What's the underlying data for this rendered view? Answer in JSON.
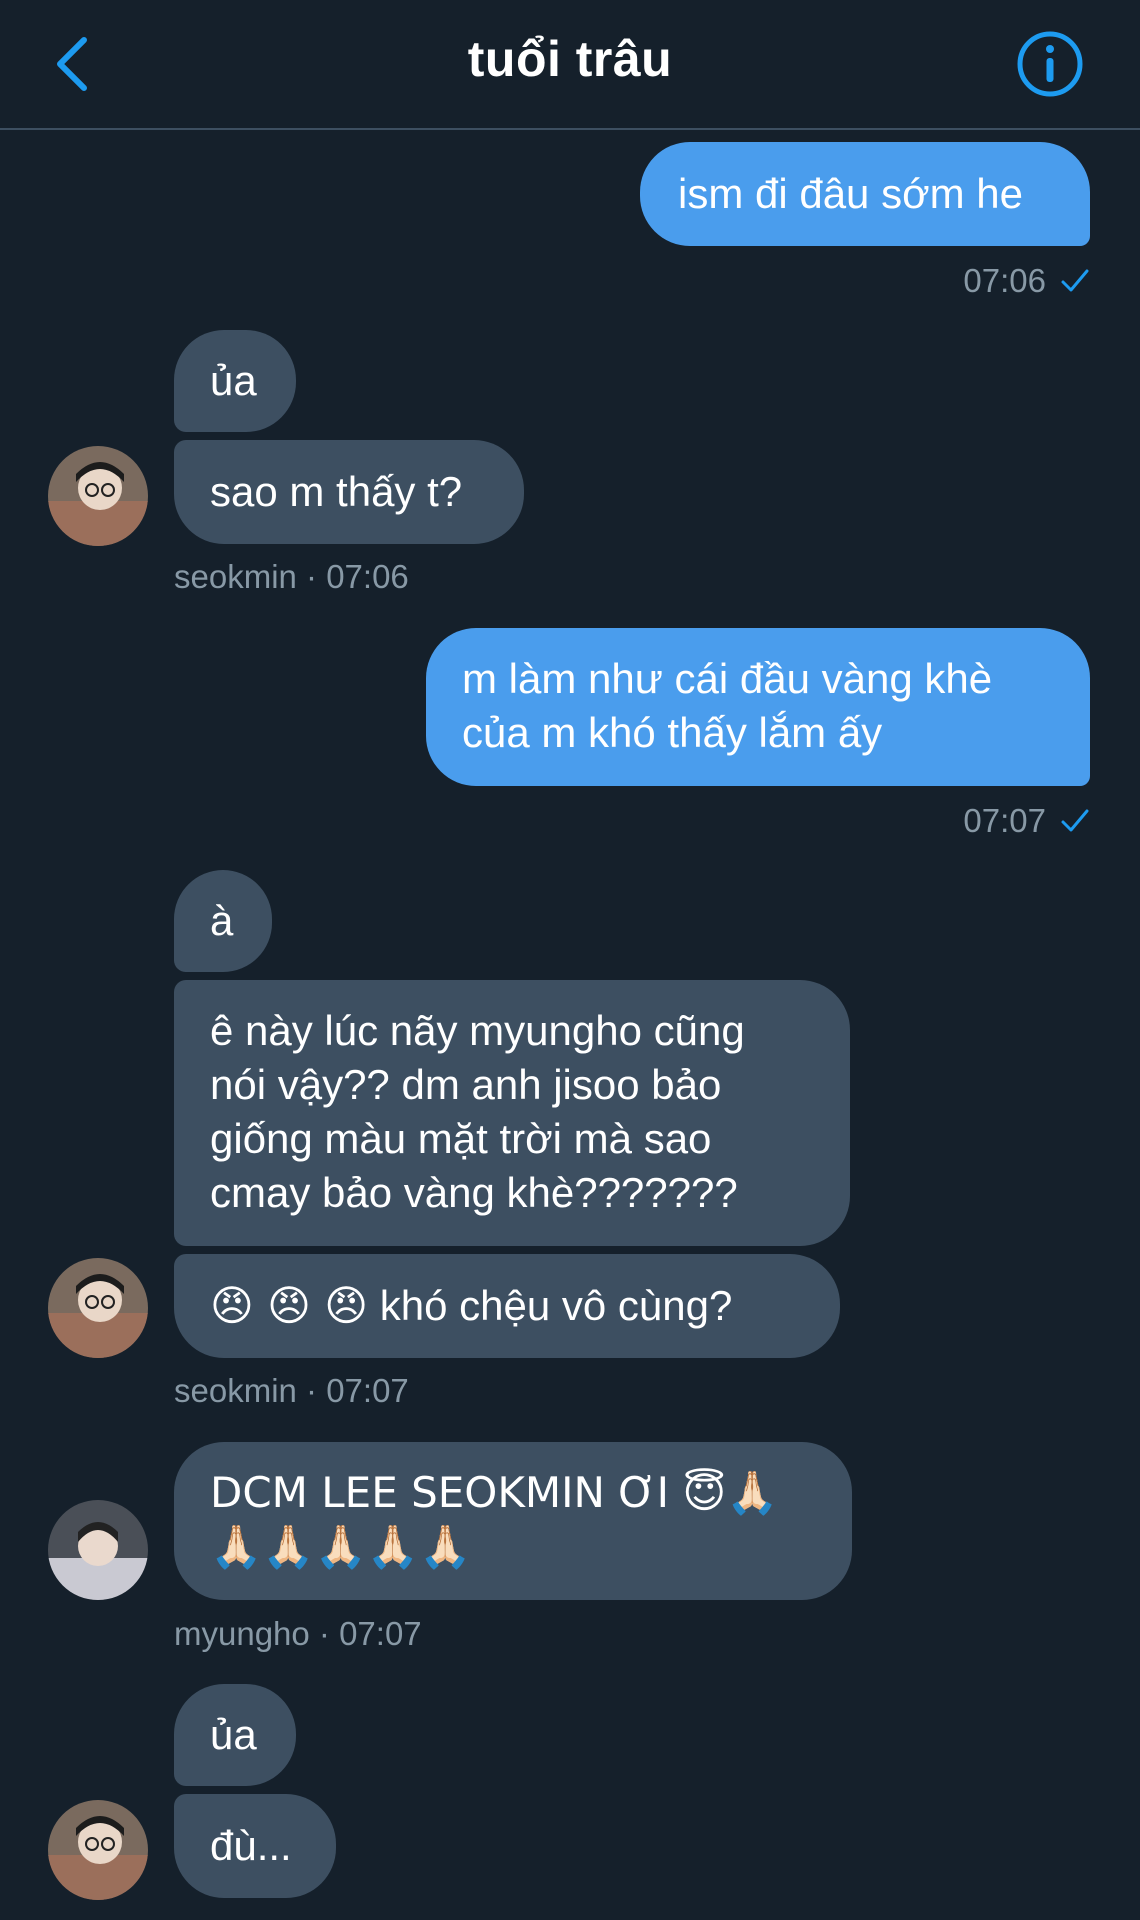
{
  "header": {
    "title": "tuổi trâu",
    "back_icon": "chevron-left-icon",
    "info_icon": "info-circle-icon",
    "accent": "#1d9bf0"
  },
  "colors": {
    "background": "#15202b",
    "outgoing_bubble": "#4a9ded",
    "incoming_bubble": "#3d4f61",
    "meta_text": "#8899a6"
  },
  "messages": {
    "m1": {
      "text": "ism đi đâu sớm he",
      "time": "07:06"
    },
    "m2a": {
      "text": "ủa"
    },
    "m2b": {
      "text": "sao m thấy t?"
    },
    "m2_meta": "seokmin · 07:06",
    "m3": {
      "line1": "m làm như cái đầu vàng khè",
      "line2": "của m khó thấy lắm ấy",
      "time": "07:07"
    },
    "m4a": {
      "text": "à"
    },
    "m4b": {
      "line1": "ê này lúc nãy myungho cũng",
      "line2": "nói vậy?? dm anh jisoo bảo",
      "line3": "giống màu mặt trời mà sao",
      "line4": "cmay bảo vàng khè???????"
    },
    "m4c": {
      "emoji": "😠 😠 😠",
      "text": "khó chệu vô cùng?"
    },
    "m4_meta": "seokmin · 07:07",
    "m5": {
      "line1": "DCM LEE SEOKMIN ƠI 😇🙏🏻",
      "line2": "🙏🏻🙏🏻🙏🏻🙏🏻🙏🏻"
    },
    "m5_meta": "myungho · 07:07",
    "m6a": {
      "text": "ủa"
    },
    "m6b": {
      "text": "đù..."
    }
  }
}
